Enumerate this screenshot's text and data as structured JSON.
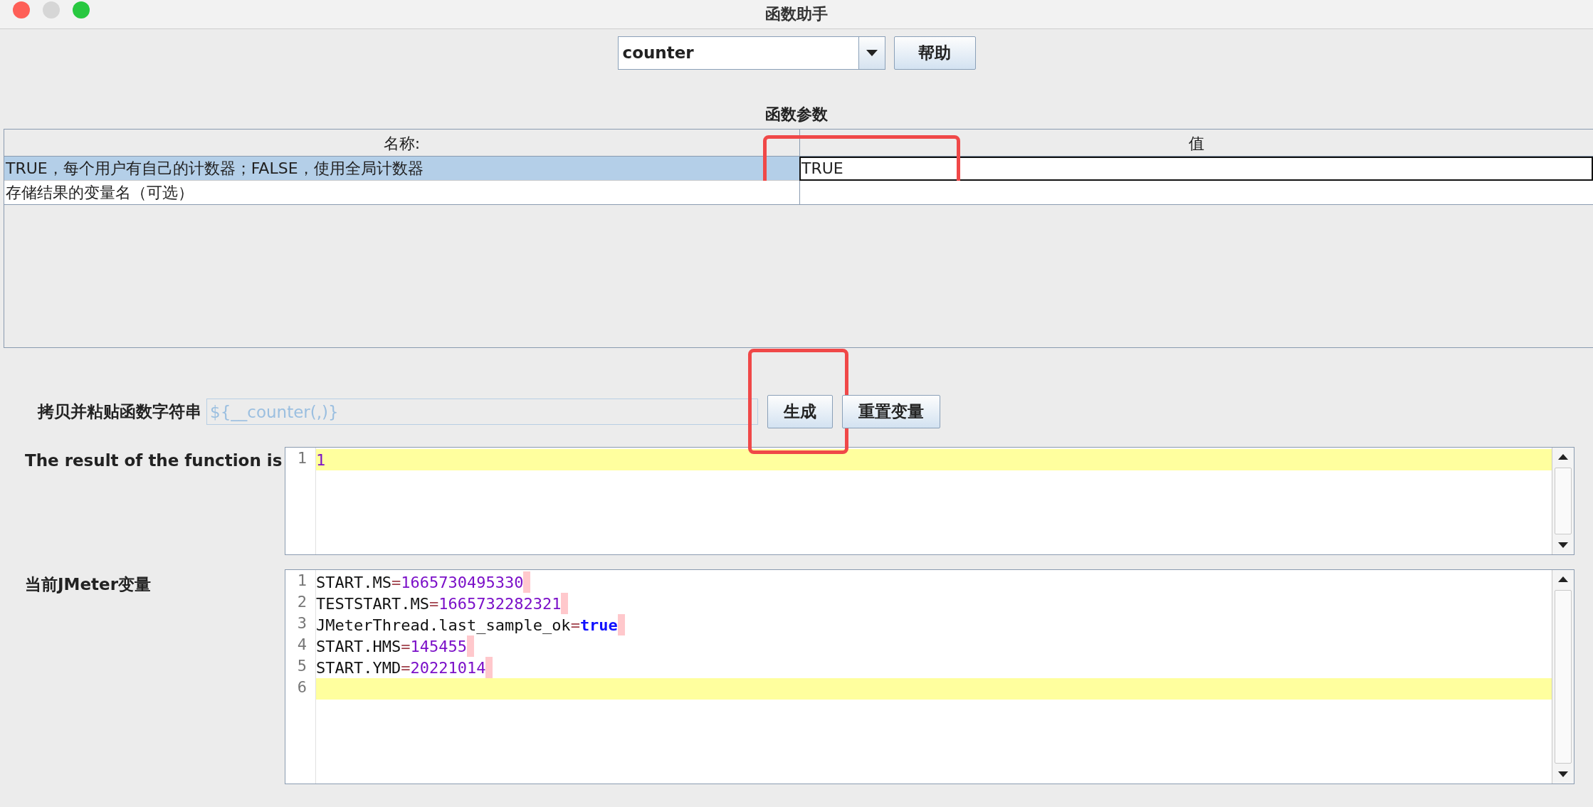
{
  "window": {
    "title": "函数助手"
  },
  "function_selector": {
    "value": "counter"
  },
  "help_button": {
    "label": "帮助"
  },
  "parameters": {
    "title": "函数参数",
    "columns": [
      "名称:",
      "值"
    ],
    "rows": [
      {
        "name": "TRUE，每个用户有自己的计数器；FALSE，使用全局计数器",
        "value": "TRUE",
        "selected": true,
        "annotated": true
      },
      {
        "name": "存储结果的变量名（可选）",
        "selected": false,
        "annotated": false
      }
    ]
  },
  "function_string": {
    "label": "拷贝并粘贴函数字符串",
    "value": "${__counter(,)}",
    "disabled": true
  },
  "buttons": [
    {
      "label": "生成",
      "annotated": true
    },
    {
      "label": "重置变量",
      "annotated": false
    }
  ],
  "result": {
    "label": "The result of the function is",
    "lines": [
      {
        "number": "1",
        "value": "1",
        "kind": "number",
        "current": true
      }
    ]
  },
  "variables": {
    "label": "当前JMeter变量",
    "lines": [
      {
        "number": "1",
        "key": "START.MS",
        "separator": "=",
        "value": "1665730495330",
        "kind": "number",
        "current": false
      },
      {
        "number": "2",
        "key": "TESTSTART.MS",
        "separator": "=",
        "value": "1665732282321",
        "kind": "number",
        "current": false
      },
      {
        "number": "3",
        "key": "JMeterThread.last_sample_ok",
        "separator": "=",
        "value": "true",
        "kind": "boolean",
        "current": false
      },
      {
        "number": "4",
        "key": "START.HMS",
        "separator": "=",
        "value": "145455",
        "kind": "number",
        "current": false
      },
      {
        "number": "5",
        "key": "START.YMD",
        "separator": "=",
        "value": "20221014",
        "kind": "number",
        "current": false
      },
      {
        "number": "6",
        "current": true
      }
    ]
  }
}
